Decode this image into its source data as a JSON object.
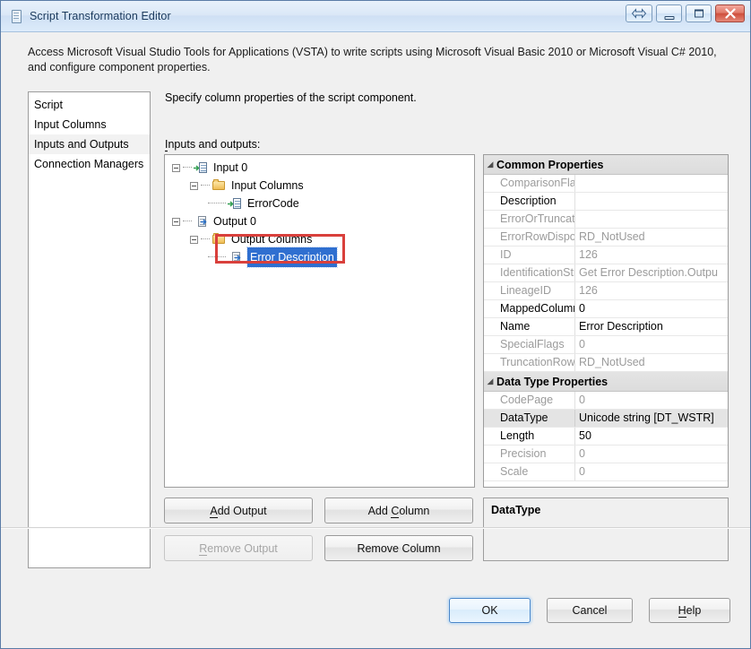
{
  "window": {
    "title": "Script Transformation Editor",
    "icon": "script-document-icon",
    "buttons": {
      "help": "help-arrow-icon",
      "minimize": "minimize-icon",
      "maximize": "maximize-icon",
      "close": "close-icon"
    }
  },
  "banner": {
    "text": "Access Microsoft Visual Studio Tools for Applications (VSTA) to write scripts using Microsoft Visual Basic 2010 or Microsoft Visual C# 2010, and configure component properties."
  },
  "sidebar": {
    "items": [
      {
        "label": "Script",
        "selected": false
      },
      {
        "label": "Input Columns",
        "selected": false
      },
      {
        "label": "Inputs and Outputs",
        "selected": true
      },
      {
        "label": "Connection Managers",
        "selected": false
      }
    ]
  },
  "main": {
    "instruction": "Specify column properties of the script component.",
    "tree_label_prefix": "I",
    "tree_label_rest": "nputs and outputs:"
  },
  "tree": {
    "nodes": [
      {
        "label": "Input 0",
        "icon": "input-icon",
        "level": 0,
        "expander": true,
        "selected": false
      },
      {
        "label": "Input Columns",
        "icon": "folder-icon",
        "level": 1,
        "expander": true,
        "selected": false
      },
      {
        "label": "ErrorCode",
        "icon": "input-column-icon",
        "level": 2,
        "expander": false,
        "selected": false
      },
      {
        "label": "Output 0",
        "icon": "output-icon",
        "level": 0,
        "expander": true,
        "selected": false
      },
      {
        "label": "Output Columns",
        "icon": "folder-icon",
        "level": 1,
        "expander": true,
        "selected": false
      },
      {
        "label": "Error Description",
        "icon": "output-column-icon",
        "level": 2,
        "expander": false,
        "selected": true
      }
    ],
    "annotation": "red-highlight-rectangle"
  },
  "tree_buttons": {
    "add_output_pre": "A",
    "add_output_post": "dd Output",
    "add_column_pre": "Add ",
    "add_column_mid": "C",
    "add_column_post": "olumn",
    "remove_output_pre": "R",
    "remove_output_post": "emove Output",
    "remove_column": "Remove Column"
  },
  "properties": {
    "groups": [
      {
        "title": "Common Properties",
        "rows": [
          {
            "name": "ComparisonFlags",
            "value": "",
            "readonly": true,
            "selected": false
          },
          {
            "name": "Description",
            "value": "",
            "readonly": false,
            "selected": false
          },
          {
            "name": "ErrorOrTruncation",
            "value": "",
            "readonly": true,
            "selected": false
          },
          {
            "name": "ErrorRowDispositi",
            "value": "RD_NotUsed",
            "readonly": true,
            "selected": false
          },
          {
            "name": "ID",
            "value": "126",
            "readonly": true,
            "selected": false
          },
          {
            "name": "IdentificationString",
            "value": "Get Error Description.Outpu",
            "readonly": true,
            "selected": false
          },
          {
            "name": "LineageID",
            "value": "126",
            "readonly": true,
            "selected": false
          },
          {
            "name": "MappedColumnID",
            "value": "0",
            "readonly": false,
            "selected": false
          },
          {
            "name": "Name",
            "value": "Error Description",
            "readonly": false,
            "selected": false
          },
          {
            "name": "SpecialFlags",
            "value": "0",
            "readonly": true,
            "selected": false
          },
          {
            "name": "TruncationRowDis",
            "value": "RD_NotUsed",
            "readonly": true,
            "selected": false
          }
        ]
      },
      {
        "title": "Data Type Properties",
        "rows": [
          {
            "name": "CodePage",
            "value": "0",
            "readonly": true,
            "selected": false
          },
          {
            "name": "DataType",
            "value": "Unicode string [DT_WSTR]",
            "readonly": false,
            "selected": true
          },
          {
            "name": "Length",
            "value": "50",
            "readonly": false,
            "selected": false
          },
          {
            "name": "Precision",
            "value": "0",
            "readonly": true,
            "selected": false
          },
          {
            "name": "Scale",
            "value": "0",
            "readonly": true,
            "selected": false
          }
        ]
      }
    ],
    "description_panel": {
      "title": "DataType",
      "text": ""
    }
  },
  "footer": {
    "ok": "OK",
    "cancel": "Cancel",
    "help_pre": "H",
    "help_post": "elp"
  },
  "colors": {
    "selection_blue": "#2f6fd0",
    "annotation_red": "#d9403c",
    "close_red": "#cf4f3c",
    "window_bg": "#f0f0f0"
  }
}
